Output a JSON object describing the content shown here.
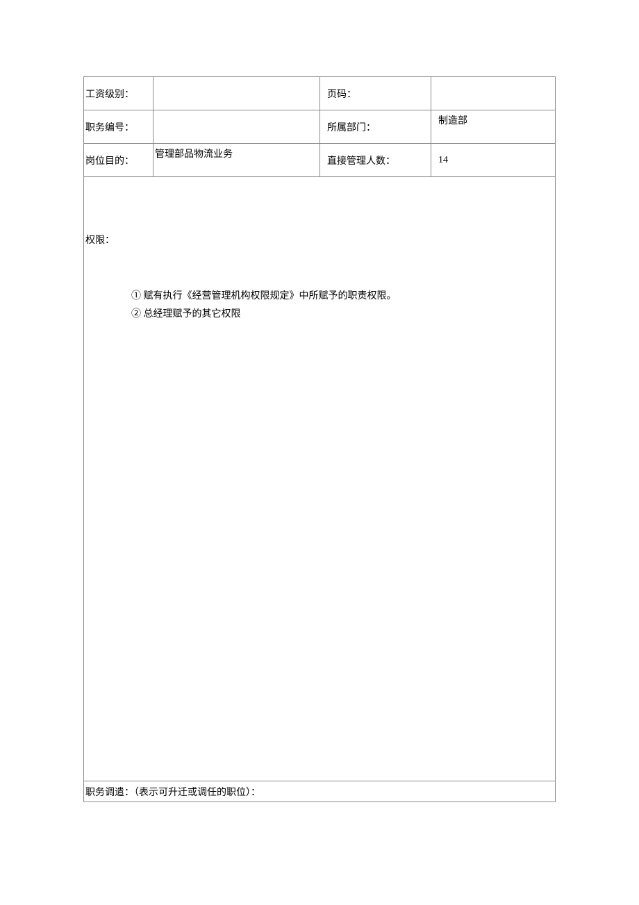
{
  "header": {
    "salary_level_label": "工资级别：",
    "salary_level_value": "",
    "page_label": "页码：",
    "page_value": "",
    "job_number_label": "职务编号：",
    "job_number_value": "",
    "department_label": "所属部门：",
    "department_value": "制造部",
    "purpose_label": "岗位目的：",
    "purpose_value": "管理部品物流业务",
    "direct_manage_label": "直接管理人数：",
    "direct_manage_value": "14"
  },
  "authority": {
    "label": "权限：",
    "items": [
      "①  赋有执行《经营管理机构权限规定》中所赋予的职责权限。",
      "②  总经理赋予的其它权限"
    ]
  },
  "transfer": {
    "text": "职务调遣：（表示可升迁或调任的职位）："
  }
}
